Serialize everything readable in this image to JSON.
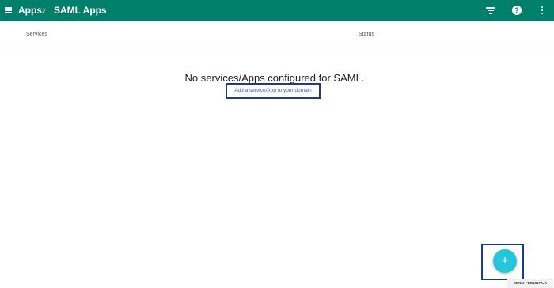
{
  "header": {
    "breadcrumb": [
      "Apps",
      "SAML Apps"
    ],
    "separator": "›",
    "icons": [
      "menu-icon",
      "filter-icon",
      "help-icon",
      "more-vert-icon"
    ],
    "help_glyph": "?"
  },
  "table": {
    "columns": [
      "Services",
      "Status"
    ]
  },
  "empty_state": {
    "message": "No services/Apps configured for SAML.",
    "link": "Add a service/App to your domain"
  },
  "fab": {
    "glyph": "+",
    "color": "#26c6da"
  },
  "feedback": {
    "label": "SEND FEEDBACK"
  },
  "colors": {
    "header_bg": "#00806a",
    "highlight_border": "#1a3a9a",
    "link": "#3b5fd6"
  }
}
